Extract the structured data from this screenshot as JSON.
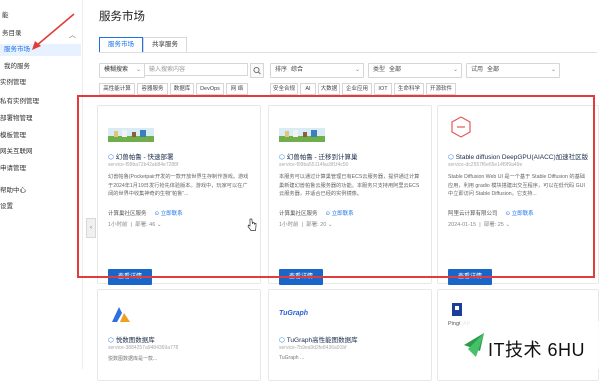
{
  "sidebar": {
    "items": [
      {
        "label": "能",
        "active": false
      },
      {
        "label": "务目录",
        "active": false
      },
      {
        "label": "服务市场",
        "active": true
      },
      {
        "label": "我的服务",
        "active": false
      },
      {
        "label": "实例管理",
        "active": false
      },
      {
        "label": "",
        "active": false
      },
      {
        "label": "私有实例管理",
        "active": false
      },
      {
        "label": "部署物管理",
        "active": false
      },
      {
        "label": "模板管理",
        "active": false
      },
      {
        "label": "网关互联网",
        "active": false
      },
      {
        "label": "申请管理",
        "active": false
      },
      {
        "label": "帮助中心",
        "active": false
      },
      {
        "label": "设置",
        "active": false
      }
    ]
  },
  "page_title": "服务市场",
  "tabs": [
    "服务市场",
    "共享服务"
  ],
  "filters": {
    "search_type": "模糊搜索",
    "search_placeholder": "输入搜索内容",
    "sort_label": "排序",
    "sort_value": "综合",
    "category_label": "类型",
    "category_value": "全部",
    "trial_label": "试用",
    "trial_value": "全部"
  },
  "chips": [
    "高性能计算",
    "容器服务",
    "数据库",
    "DevOps",
    "网 络",
    "安全合规",
    "AI",
    "大数据",
    "企业应用",
    "IOT",
    "生命科学",
    "开源软件"
  ],
  "cards": [
    {
      "name": "幻兽帕鲁 - 快速部署",
      "service_id": "service-f99ba72b42ab84e7288f",
      "description": "幻兽帕鲁(Pocketpair开发的一款开放世界生存制作游戏。游戏于2024年1月19日发行抢先体验版本。游戏中，玩家可以在广阔的世界中收集神奇的生物“帕鲁”...",
      "provider": "计算巢社区服务",
      "contact": "立即联系",
      "time": "1小时前",
      "deploy_count": "部署: 46",
      "button": "查看详情"
    },
    {
      "name": "幻兽帕鲁 - 迁移到计算巢",
      "service_id": "service-f99ba55114fac8f1f4c50",
      "description": "本服务可以通过计算巢管理已有ECS云服务器，提供通过计算巢新建幻兽帕鲁云服务器的功能。本服务只支持用阿里云ECS云服务器，并适合已经的实例镜像。",
      "provider": "计算巢社区服务",
      "contact": "立即联系",
      "time": "1小时前",
      "deploy_count": "部署: 20",
      "button": "查看详情"
    },
    {
      "name": "Stable diffusion DeepGPU(AIACC)加速社区版",
      "service_id": "service-dc2557f6e65e14f9f9a49e",
      "description": "Stable Diffusion Web UI 是一个基于 Stable Diffusion 的基础应用，利用 gradio 模块搭建出交互程序，可以在低代码 GUI 中立即访问 Stable Diffusion，它支持...",
      "provider": "阿里云计算有限公司",
      "contact": "立即联系",
      "time": "2024-01-15",
      "deploy_count": "部署: 25",
      "button": "查看详情"
    }
  ],
  "cards_row2": [
    {
      "name": "悦数图数据库",
      "service_id": "service-3884257a9484369a778",
      "description": "悦数图数据库是一款..."
    },
    {
      "name": "TuGraph高性能图数据库",
      "service_id": "service-7b9ea9d2fe8436a91bf",
      "description": "TuGraph ..."
    },
    {
      "name": "",
      "service_id": "",
      "description": ""
    }
  ],
  "logos": {
    "tugraph": "TuGraph",
    "pingcap": "PingCAP"
  },
  "watermark": "IT技术 6HU",
  "colors": {
    "accent": "#1a73e8",
    "button": "#1a65c8",
    "highlight_frame": "#e23b3b"
  }
}
